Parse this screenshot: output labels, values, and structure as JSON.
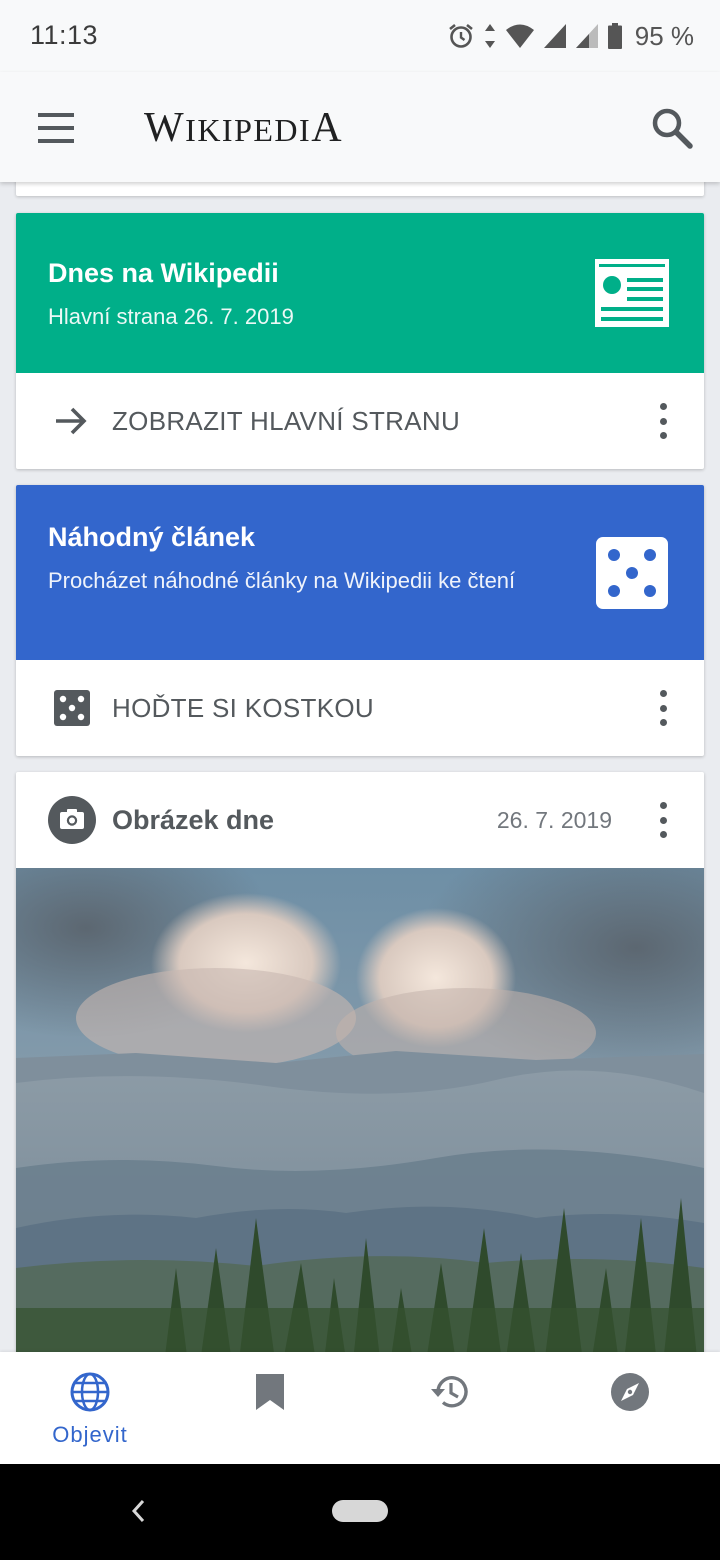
{
  "status_bar": {
    "time": "11:13",
    "battery": "95 %",
    "icons": [
      "alarm-icon",
      "data-arrows-icon",
      "wifi-icon",
      "signal-icon",
      "signal-icon",
      "battery-icon"
    ]
  },
  "app_bar": {
    "logo_text": "Wikipedia",
    "menu_icon": "menu-icon",
    "search_icon": "search-icon"
  },
  "cards": {
    "featured": {
      "title": "Dnes na Wikipedii",
      "subtitle": "Hlavní strana 26. 7. 2019",
      "action": "ZOBRAZIT HLAVNÍ STRANU",
      "color": "#00af89",
      "icon": "newspaper-icon",
      "action_icon": "arrow-right-icon"
    },
    "random": {
      "title": "Náhodný článek",
      "subtitle": "Procházet náhodné články na Wikipedii ke čtení",
      "action": "HOĎTE SI KOSTKOU",
      "color": "#3366cc",
      "icon": "dice-icon",
      "action_icon": "dice-icon"
    },
    "picture": {
      "title": "Obrázek dne",
      "date": "26. 7. 2019",
      "icon": "camera-icon"
    }
  },
  "bottom_nav": {
    "items": [
      {
        "label": "Objevit",
        "icon": "globe-icon",
        "active": true
      },
      {
        "label": "",
        "icon": "bookmark-icon",
        "active": false
      },
      {
        "label": "",
        "icon": "history-icon",
        "active": false
      },
      {
        "label": "",
        "icon": "compass-icon",
        "active": false
      }
    ],
    "active_color": "#3366cc",
    "inactive_color": "#72777d"
  },
  "system_nav": {
    "buttons": [
      "back-icon",
      "home-pill"
    ]
  }
}
